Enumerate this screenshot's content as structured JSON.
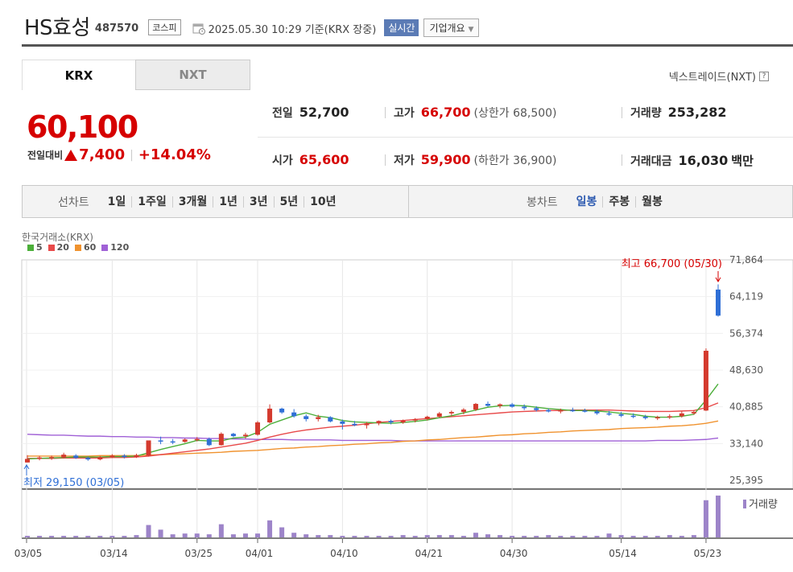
{
  "header": {
    "company": "HS효성",
    "code": "487570",
    "market": "코스피",
    "datetime": "2025.05.30 10:29  기준(KRX 장중)",
    "realtime": "실시간",
    "company_dropdown": "기업개요"
  },
  "tabs": {
    "krx": "KRX",
    "nxt": "NXT",
    "nxt_link": "넥스트레이드(NXT)",
    "help": "?"
  },
  "price": {
    "current": "60,100",
    "change_label": "전일대비",
    "change": "7,400",
    "change_pct": "+14.04%"
  },
  "stats": {
    "prev_close": {
      "label": "전일",
      "value": "52,700"
    },
    "open": {
      "label": "시가",
      "value": "65,600"
    },
    "high": {
      "label": "고가",
      "value": "66,700",
      "sub": "(상한가 68,500)"
    },
    "low": {
      "label": "저가",
      "value": "59,900",
      "sub": "(하한가 36,900)"
    },
    "volume": {
      "label": "거래량",
      "value": "253,282"
    },
    "amount": {
      "label": "거래대금",
      "value": "16,030",
      "unit": "백만"
    }
  },
  "periodbar": {
    "line_label": "선차트",
    "line_items": [
      "1일",
      "1주일",
      "3개월",
      "1년",
      "3년",
      "5년",
      "10년"
    ],
    "candle_label": "봉차트",
    "candle_items": [
      "일봉",
      "주봉",
      "월봉"
    ],
    "active": "일봉"
  },
  "colors": {
    "up": "#d43a2e",
    "down": "#2f6fd6",
    "ma5": "#4caf3a",
    "ma20": "#e84a4a",
    "ma60": "#f0922e",
    "ma120": "#a061d6",
    "volume": "#9d84c9"
  },
  "chart_data": {
    "type": "candlestick",
    "source": "한국거래소(KRX)",
    "legend": [
      {
        "name": "5",
        "color": "#4caf3a"
      },
      {
        "name": "20",
        "color": "#e84a4a"
      },
      {
        "name": "60",
        "color": "#f0922e"
      },
      {
        "name": "120",
        "color": "#a061d6"
      }
    ],
    "y_ticks": [
      "71,864",
      "64,119",
      "56,374",
      "48,630",
      "40,885",
      "33,140",
      "25,395"
    ],
    "ylim": [
      25395,
      71864
    ],
    "x_ticks": [
      "03/05",
      "03/14",
      "03/25",
      "04/01",
      "04/10",
      "04/21",
      "04/30",
      "05/14",
      "05/23"
    ],
    "high_note": "최고 66,700 (05/30)",
    "low_note": "최저 29,150 (03/05)",
    "volume_label": "거래량",
    "candles": [
      [
        29150,
        30700,
        29150,
        29900
      ],
      [
        29900,
        30500,
        29600,
        30200
      ],
      [
        30100,
        30600,
        29700,
        30300
      ],
      [
        30200,
        31200,
        30000,
        30800
      ],
      [
        30600,
        30900,
        29900,
        30100
      ],
      [
        30100,
        30400,
        29500,
        29800
      ],
      [
        29800,
        30500,
        29600,
        30300
      ],
      [
        30300,
        30900,
        30100,
        30600
      ],
      [
        30600,
        30900,
        30000,
        30300
      ],
      [
        30300,
        31000,
        30100,
        30700
      ],
      [
        30600,
        33500,
        30400,
        33800
      ],
      [
        33800,
        34600,
        33000,
        33600
      ],
      [
        33600,
        34100,
        33000,
        33500
      ],
      [
        33500,
        34200,
        33300,
        34000
      ],
      [
        34000,
        34500,
        33600,
        34100
      ],
      [
        34100,
        34400,
        32600,
        32800
      ],
      [
        32800,
        35500,
        32700,
        35200
      ],
      [
        35200,
        35400,
        34500,
        34700
      ],
      [
        34700,
        35400,
        34200,
        35000
      ],
      [
        35000,
        37900,
        34800,
        37600
      ],
      [
        37600,
        41400,
        37400,
        40500
      ],
      [
        40500,
        40700,
        39400,
        39700
      ],
      [
        39700,
        40400,
        38600,
        38900
      ],
      [
        38900,
        39300,
        37800,
        38300
      ],
      [
        38300,
        39200,
        37800,
        38700
      ],
      [
        38700,
        38900,
        37600,
        37800
      ],
      [
        37800,
        38200,
        36100,
        37300
      ],
      [
        37300,
        37900,
        36800,
        37000
      ],
      [
        37000,
        37700,
        36300,
        37400
      ],
      [
        37400,
        38000,
        37000,
        37900
      ],
      [
        37900,
        38200,
        37200,
        37600
      ],
      [
        37600,
        38200,
        37300,
        38000
      ],
      [
        38000,
        38500,
        37600,
        38300
      ],
      [
        38300,
        39000,
        38000,
        38800
      ],
      [
        38800,
        39800,
        38600,
        39500
      ],
      [
        39500,
        40100,
        39000,
        39800
      ],
      [
        39800,
        40600,
        39300,
        40300
      ],
      [
        40300,
        41700,
        40000,
        41500
      ],
      [
        41500,
        42000,
        40900,
        41100
      ],
      [
        41100,
        41600,
        40600,
        41400
      ],
      [
        41400,
        41700,
        40700,
        40900
      ],
      [
        40900,
        41400,
        40200,
        40600
      ],
      [
        40600,
        41000,
        39900,
        40200
      ],
      [
        40200,
        40500,
        39700,
        39900
      ],
      [
        39900,
        40500,
        39500,
        40200
      ],
      [
        40200,
        40700,
        39800,
        40100
      ],
      [
        40100,
        40500,
        39700,
        39900
      ],
      [
        39900,
        40300,
        39200,
        39500
      ],
      [
        39500,
        40000,
        39000,
        39300
      ],
      [
        39300,
        39800,
        38700,
        39000
      ],
      [
        39000,
        39500,
        38500,
        38800
      ],
      [
        38800,
        39200,
        38200,
        38500
      ],
      [
        38500,
        39000,
        38100,
        38700
      ],
      [
        38700,
        39300,
        38300,
        38900
      ],
      [
        38900,
        39900,
        38600,
        39500
      ],
      [
        39500,
        40200,
        39200,
        39800
      ],
      [
        40100,
        53200,
        40000,
        52700
      ],
      [
        65600,
        66700,
        59900,
        60100
      ]
    ],
    "ma5": [
      29900,
      30000,
      30100,
      30200,
      30300,
      30300,
      30300,
      30400,
      30400,
      30500,
      31200,
      31900,
      32500,
      33100,
      33800,
      33700,
      33700,
      34300,
      34500,
      35500,
      37200,
      38100,
      39000,
      39600,
      38900,
      38600,
      38000,
      37700,
      37600,
      37500,
      37400,
      37600,
      37800,
      38100,
      38600,
      39000,
      39600,
      40200,
      40800,
      41100,
      41200,
      41100,
      40800,
      40500,
      40300,
      40100,
      40100,
      40000,
      39800,
      39500,
      39300,
      38900,
      38700,
      38700,
      38900,
      39300,
      42300,
      45700
    ],
    "ma20": [
      30000,
      30000,
      30000,
      30100,
      30100,
      30100,
      30100,
      30200,
      30200,
      30300,
      30500,
      30800,
      31100,
      31400,
      31700,
      32000,
      32400,
      32800,
      33200,
      33800,
      34500,
      35100,
      35600,
      36000,
      36300,
      36600,
      36800,
      37000,
      37300,
      37600,
      37800,
      38000,
      38200,
      38400,
      38600,
      38800,
      39000,
      39200,
      39400,
      39600,
      39800,
      39900,
      40000,
      40100,
      40100,
      40200,
      40200,
      40200,
      40200,
      40100,
      40000,
      39900,
      39900,
      39900,
      40000,
      40100,
      40700,
      41700
    ],
    "ma60": [
      30500,
      30500,
      30500,
      30500,
      30500,
      30500,
      30600,
      30600,
      30600,
      30600,
      30700,
      30800,
      30900,
      31000,
      31100,
      31200,
      31300,
      31500,
      31600,
      31700,
      31900,
      32100,
      32200,
      32400,
      32500,
      32700,
      32800,
      33000,
      33100,
      33300,
      33400,
      33600,
      33700,
      33900,
      34000,
      34200,
      34400,
      34500,
      34700,
      34900,
      35000,
      35200,
      35300,
      35500,
      35600,
      35800,
      35900,
      36000,
      36100,
      36300,
      36400,
      36500,
      36600,
      36800,
      36900,
      37100,
      37400,
      37900
    ],
    "ma120": [
      35100,
      35000,
      34900,
      34900,
      34800,
      34700,
      34700,
      34600,
      34600,
      34500,
      34500,
      34400,
      34400,
      34300,
      34300,
      34200,
      34200,
      34100,
      34100,
      34000,
      34000,
      34000,
      33900,
      33900,
      33900,
      33900,
      33800,
      33800,
      33800,
      33800,
      33800,
      33700,
      33700,
      33700,
      33700,
      33700,
      33700,
      33700,
      33700,
      33700,
      33700,
      33700,
      33700,
      33700,
      33700,
      33700,
      33700,
      33700,
      33700,
      33700,
      33700,
      33700,
      33800,
      33800,
      33800,
      33900,
      34000,
      34300
    ],
    "volume": [
      2,
      2,
      2,
      2,
      2,
      2,
      2,
      2,
      2,
      3,
      16,
      10,
      4,
      5,
      5,
      4,
      17,
      4,
      5,
      5,
      22,
      13,
      6,
      4,
      3,
      3,
      2,
      2,
      2,
      2,
      2,
      3,
      2,
      3,
      3,
      3,
      2,
      6,
      4,
      3,
      2,
      2,
      2,
      3,
      2,
      2,
      2,
      2,
      5,
      3,
      2,
      2,
      2,
      3,
      2,
      3,
      48,
      54
    ]
  }
}
